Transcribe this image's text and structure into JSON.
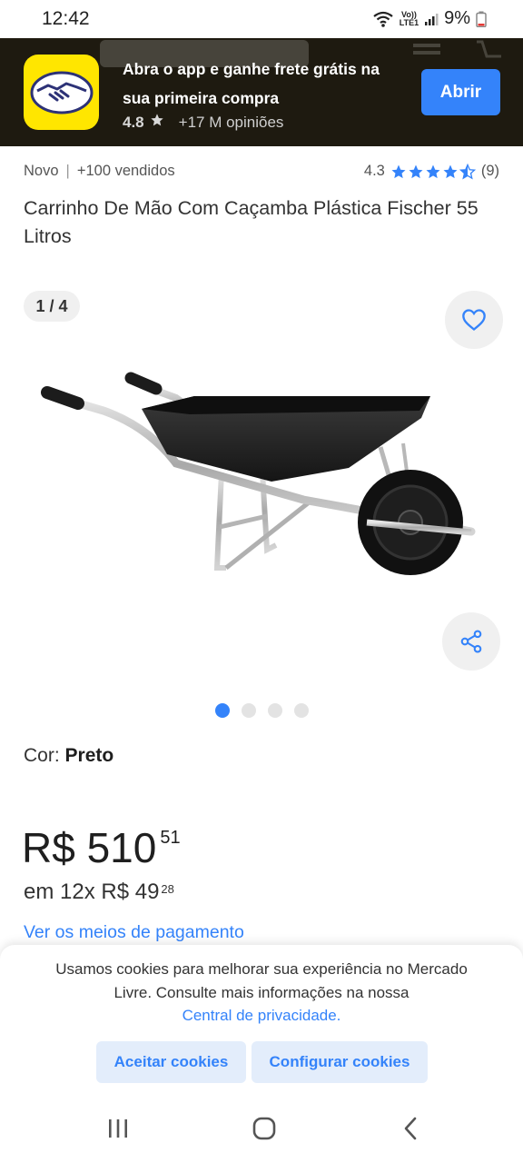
{
  "status_bar": {
    "time": "12:42",
    "network_label_top": "Vo))",
    "network_label_bottom": "LTE1",
    "battery": "9%"
  },
  "app_banner": {
    "title": "Abra o app e ganhe frete grátis na sua primeira compra",
    "rating": "4.8",
    "reviews": "+17 M opiniões",
    "open_label": "Abrir",
    "logo_color": "#ffe600",
    "button_color": "#3483fa"
  },
  "product": {
    "condition": "Novo",
    "sold": "+100 vendidos",
    "rating": "4.3",
    "review_count": "(9)",
    "stars": 4.3,
    "title": "Carrinho De Mão Com Caçamba Plástica Fischer 55 Litros"
  },
  "gallery": {
    "counter": "1 / 4",
    "current": 1,
    "total": 4,
    "favorite_icon": "heart-icon",
    "share_icon": "share-icon"
  },
  "variant": {
    "label": "Cor: ",
    "value": "Preto"
  },
  "price": {
    "main": "R$ 510",
    "cents": "51",
    "installments": "em 12x R$ 49",
    "installment_cents": "28",
    "payment_link": "Ver os meios de pagamento"
  },
  "cookies": {
    "text": "Usamos cookies para melhorar sua experiência no Mercado Livre. Consulte mais informações na nossa",
    "link": "Central de privacidade.",
    "accept_label": "Aceitar cookies",
    "configure_label": "Configurar cookies"
  },
  "nav_bar": {
    "recents_icon": "recents-icon",
    "home_icon": "home-icon",
    "back_icon": "back-icon"
  }
}
